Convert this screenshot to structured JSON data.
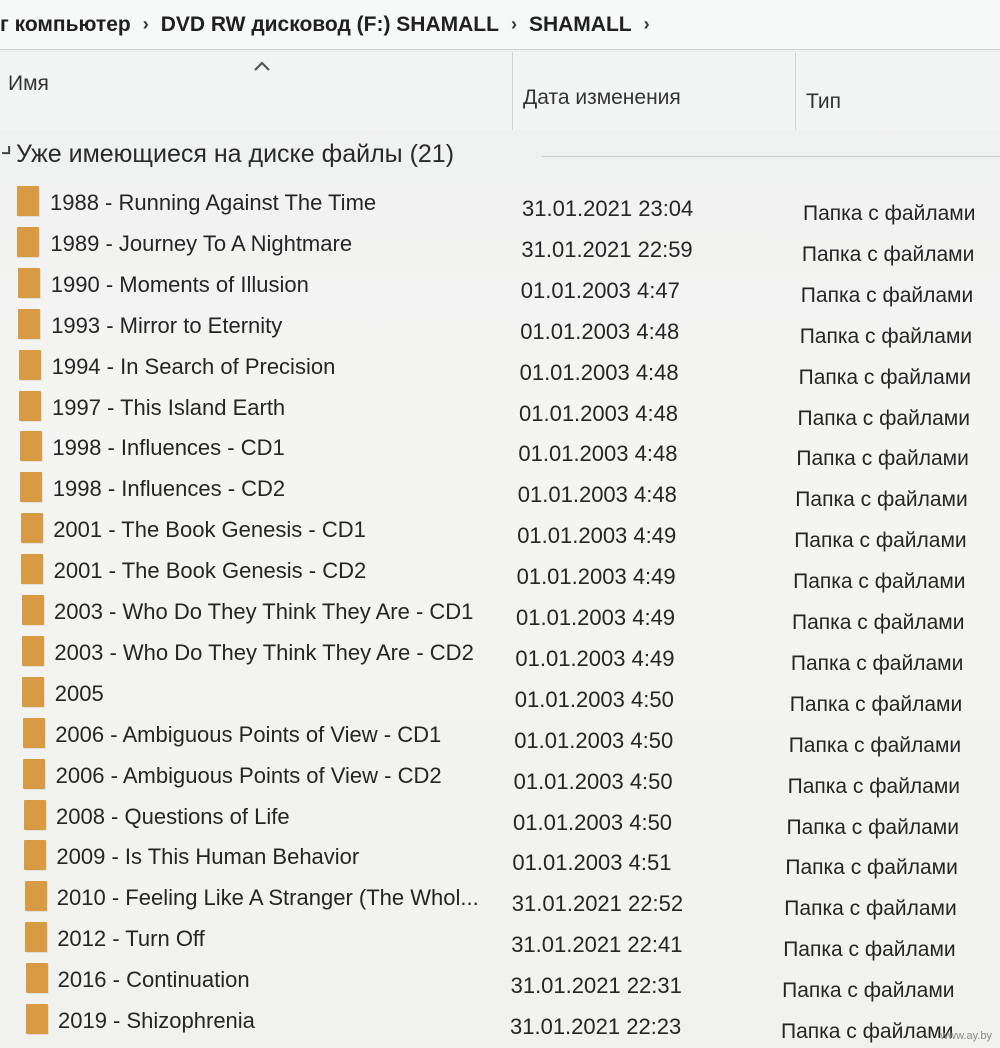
{
  "breadcrumb": {
    "items": [
      "г компьютер",
      "DVD RW дисковод (F:) SHAMALL",
      "SHAMALL"
    ],
    "separator": "›"
  },
  "columns": {
    "name": "Имя",
    "date": "Дата изменения",
    "type": "Тип",
    "sort_icon": "chevron-up-icon"
  },
  "group": {
    "title": "Уже имеющиеся на диске файлы (21)",
    "chevron": "chevron-down-icon"
  },
  "files": [
    {
      "name": "1988 - Running Against The Time",
      "date": "31.01.2021 23:04",
      "type": "Папка с файлами"
    },
    {
      "name": "1989 - Journey To A Nightmare",
      "date": "31.01.2021 22:59",
      "type": "Папка с файлами"
    },
    {
      "name": "1990 - Moments of Illusion",
      "date": "01.01.2003 4:47",
      "type": "Папка с файлами"
    },
    {
      "name": "1993 - Mirror to Eternity",
      "date": "01.01.2003 4:48",
      "type": "Папка с файлами"
    },
    {
      "name": "1994 - In Search of Precision",
      "date": "01.01.2003 4:48",
      "type": "Папка с файлами"
    },
    {
      "name": "1997 - This Island Earth",
      "date": "01.01.2003 4:48",
      "type": "Папка с файлами"
    },
    {
      "name": "1998 - Influences - CD1",
      "date": "01.01.2003 4:48",
      "type": "Папка с файлами"
    },
    {
      "name": "1998 - Influences - CD2",
      "date": "01.01.2003 4:48",
      "type": "Папка с файлами"
    },
    {
      "name": "2001 - The Book Genesis - CD1",
      "date": "01.01.2003 4:49",
      "type": "Папка с файлами"
    },
    {
      "name": "2001 - The Book Genesis - CD2",
      "date": "01.01.2003 4:49",
      "type": "Папка с файлами"
    },
    {
      "name": "2003 - Who Do They Think They Are - CD1",
      "date": "01.01.2003 4:49",
      "type": "Папка с файлами"
    },
    {
      "name": "2003 - Who Do They Think They Are - CD2",
      "date": "01.01.2003 4:49",
      "type": "Папка с файлами"
    },
    {
      "name": "2005",
      "date": "01.01.2003 4:50",
      "type": "Папка с файлами"
    },
    {
      "name": "2006 - Ambiguous Points of View - CD1",
      "date": "01.01.2003 4:50",
      "type": "Папка с файлами"
    },
    {
      "name": "2006 - Ambiguous Points of View - CD2",
      "date": "01.01.2003 4:50",
      "type": "Папка с файлами"
    },
    {
      "name": "2008 - Questions of Life",
      "date": "01.01.2003 4:50",
      "type": "Папка с файлами"
    },
    {
      "name": "2009 - Is This Human Behavior",
      "date": "01.01.2003 4:51",
      "type": "Папка с файлами"
    },
    {
      "name": "2010 - Feeling Like A Stranger (The Whol...",
      "date": "31.01.2021 22:52",
      "type": "Папка с файлами"
    },
    {
      "name": "2012 - Turn Off",
      "date": "31.01.2021 22:41",
      "type": "Папка с файлами"
    },
    {
      "name": "2016 - Continuation",
      "date": "31.01.2021 22:31",
      "type": "Папка с файлами"
    },
    {
      "name": "2019 - Shizophrenia",
      "date": "31.01.2021 22:23",
      "type": "Папка с файлами"
    }
  ],
  "folder_icon": "folder-icon",
  "folder_color": "#d99a44",
  "watermark": "www.ay.by"
}
